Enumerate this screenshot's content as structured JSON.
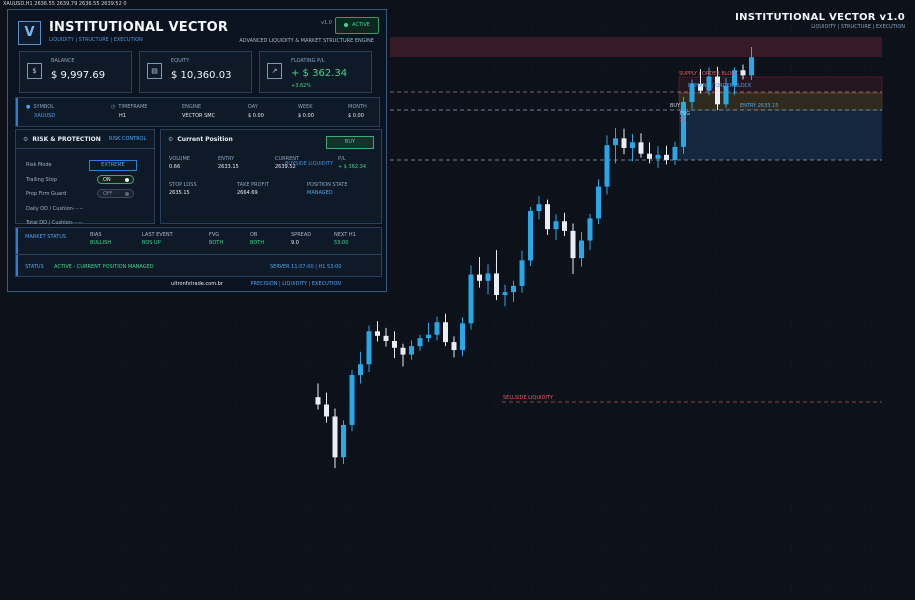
{
  "top_bar": {
    "ohlc_text": "XAUUSD,H1  2636.55  2639.79  2636.55  2639.52  0"
  },
  "watermark": {
    "title": "INSTITUTIONAL VECTOR  v1.0",
    "subtitle": "LIQUIDITY | STRUCTURE | EXECUTION"
  },
  "panel": {
    "logo_letter": "V",
    "title": "INSTITUTIONAL VECTOR",
    "subtitle": "LIQUIDITY | STRUCTURE | EXECUTION",
    "version": "v1.0",
    "status_badge": "ACTIVE",
    "tagline": "ADVANCED LIQUIDITY & MARKET STRUCTURE ENGINE",
    "cards": [
      {
        "icon": "dollar-icon",
        "glyph": "$",
        "label": "BALANCE",
        "value": "$ 9,997.69"
      },
      {
        "icon": "wallet-icon",
        "glyph": "▤",
        "label": "EQUITY",
        "value": "$ 10,360.03"
      },
      {
        "icon": "trend-up-icon",
        "glyph": "↗",
        "label": "FLOATING P/L",
        "value": "+ $ 362.34",
        "sub": "+3.62%"
      }
    ],
    "symbol_row": {
      "symbol_label": "SYMBOL",
      "symbol": "XAUUSD",
      "timeframe_label": "TIMEFRAME",
      "timeframe": "H1",
      "engine_label": "ENGINE",
      "engine": "VECTOR SMC",
      "day_label": "DAY",
      "day": "$ 0.00",
      "week_label": "WEEK",
      "week": "$ 0.00",
      "month_label": "MONTH",
      "month": "$ 0.00"
    },
    "risk": {
      "title": "RISK & PROTECTION",
      "tab": "RISK CONTROL",
      "risk_mode_label": "Risk Mode",
      "risk_mode": "EXTREME",
      "trailing_stop_label": "Trailing Stop",
      "trailing_stop": "ON",
      "prop_firm_label": "Prop Firm Guard",
      "prop_firm": "OFF",
      "daily_dd": "Daily DD / Cushion- - --",
      "total_dd": "Total DD / Cushion- - --"
    },
    "position": {
      "title": "Current Position",
      "side": "BUY",
      "volume_label": "VOLUME",
      "volume": "0.66",
      "entry_label": "ENTRY",
      "entry": "2633.15",
      "current_label": "CURRENT",
      "current": "2639.52",
      "pl_label": "P/L",
      "pl": "+ $ 362.34",
      "overlap_text": "BUYSIDE LIQUIDITY",
      "stop_loss_label": "STOP LOSS",
      "stop_loss": "2635.15",
      "take_profit_label": "TAKE PROFIT",
      "take_profit": "2664.69",
      "position_state_label": "POSITION STATE",
      "position_state": "MANAGED"
    },
    "market": {
      "status_label": "MARKET STATUS",
      "bias_label": "BIAS",
      "bias": "BULLISH",
      "last_event_label": "LAST EVENT",
      "last_event": "BOS UP",
      "fvg_label": "FVG",
      "fvg": "BOTH",
      "ob_label": "OB",
      "ob": "BOTH",
      "spread_label": "SPREAD",
      "spread": "9.0",
      "next_label": "NEXT H1",
      "next": "53:00",
      "status_word": "STATUS",
      "status_text": "ACTIVE - CURRENT POSITION MANAGED",
      "server_text": "SERVER 11:07:00  |  H1 53:00"
    },
    "footer": {
      "site": "ultronfxtrade.com.br",
      "tagline": "PRECISION | LIQUIDITY | EXECUTION"
    }
  },
  "chart_labels": {
    "supply": "SUPPLY / ORDER BLOCK",
    "demand": "DEMAND / ORDER BLOCK",
    "entry": "ENTRY  2633.15",
    "sellside": "SELLSIDE LIQUIDITY",
    "buyside_short": "BUY",
    "fvg_short": "FVG",
    "sl_short": "SL"
  },
  "colors": {
    "bull": "#29a8e8",
    "bear": "#e8eef4",
    "background": "#0c111a",
    "accent": "#2e7fd0",
    "green": "#3fd68a",
    "red": "#e04a4a"
  },
  "candles": [
    {
      "o": 2579.6,
      "h": 2582.0,
      "l": 2577.4,
      "c": 2578.3
    },
    {
      "o": 2578.3,
      "h": 2580.4,
      "l": 2575.1,
      "c": 2576.2
    },
    {
      "o": 2576.2,
      "h": 2577.6,
      "l": 2567.1,
      "c": 2569.0
    },
    {
      "o": 2569.0,
      "h": 2575.5,
      "l": 2567.8,
      "c": 2574.7
    },
    {
      "o": 2574.7,
      "h": 2584.4,
      "l": 2573.6,
      "c": 2583.5
    },
    {
      "o": 2583.5,
      "h": 2587.6,
      "l": 2582.0,
      "c": 2585.4
    },
    {
      "o": 2585.4,
      "h": 2592.2,
      "l": 2584.0,
      "c": 2591.2
    },
    {
      "o": 2591.2,
      "h": 2593.0,
      "l": 2589.4,
      "c": 2590.4
    },
    {
      "o": 2590.4,
      "h": 2591.8,
      "l": 2588.5,
      "c": 2589.5
    },
    {
      "o": 2589.5,
      "h": 2591.2,
      "l": 2586.5,
      "c": 2588.3
    },
    {
      "o": 2588.3,
      "h": 2589.0,
      "l": 2585.0,
      "c": 2587.1
    },
    {
      "o": 2587.1,
      "h": 2589.6,
      "l": 2586.2,
      "c": 2588.6
    },
    {
      "o": 2588.6,
      "h": 2590.6,
      "l": 2587.8,
      "c": 2590.0
    },
    {
      "o": 2590.0,
      "h": 2592.7,
      "l": 2589.3,
      "c": 2590.6
    },
    {
      "o": 2590.6,
      "h": 2593.8,
      "l": 2589.6,
      "c": 2592.8
    },
    {
      "o": 2592.8,
      "h": 2594.3,
      "l": 2588.6,
      "c": 2589.3
    },
    {
      "o": 2589.3,
      "h": 2590.3,
      "l": 2586.6,
      "c": 2587.9
    },
    {
      "o": 2587.9,
      "h": 2593.7,
      "l": 2586.8,
      "c": 2592.6
    },
    {
      "o": 2592.6,
      "h": 2602.8,
      "l": 2591.5,
      "c": 2601.2
    },
    {
      "o": 2601.2,
      "h": 2604.3,
      "l": 2598.9,
      "c": 2600.1
    },
    {
      "o": 2600.1,
      "h": 2603.0,
      "l": 2597.7,
      "c": 2601.4
    },
    {
      "o": 2601.4,
      "h": 2605.5,
      "l": 2596.7,
      "c": 2597.6
    },
    {
      "o": 2597.6,
      "h": 2599.4,
      "l": 2595.6,
      "c": 2598.1
    },
    {
      "o": 2598.1,
      "h": 2600.1,
      "l": 2596.4,
      "c": 2599.2
    },
    {
      "o": 2599.2,
      "h": 2605.4,
      "l": 2598.0,
      "c": 2603.7
    },
    {
      "o": 2603.7,
      "h": 2613.1,
      "l": 2602.7,
      "c": 2612.4
    },
    {
      "o": 2612.4,
      "h": 2615.0,
      "l": 2610.9,
      "c": 2613.6
    },
    {
      "o": 2613.6,
      "h": 2614.4,
      "l": 2608.2,
      "c": 2609.2
    },
    {
      "o": 2609.2,
      "h": 2611.8,
      "l": 2607.3,
      "c": 2610.6
    },
    {
      "o": 2610.6,
      "h": 2612.1,
      "l": 2608.0,
      "c": 2608.9
    },
    {
      "o": 2608.9,
      "h": 2610.2,
      "l": 2601.3,
      "c": 2604.1
    },
    {
      "o": 2604.1,
      "h": 2608.7,
      "l": 2602.6,
      "c": 2607.2
    },
    {
      "o": 2607.2,
      "h": 2611.9,
      "l": 2605.5,
      "c": 2611.1
    },
    {
      "o": 2611.1,
      "h": 2618.0,
      "l": 2610.1,
      "c": 2616.7
    },
    {
      "o": 2616.7,
      "h": 2625.7,
      "l": 2615.3,
      "c": 2624.0
    },
    {
      "o": 2624.0,
      "h": 2627.0,
      "l": 2620.8,
      "c": 2625.2
    },
    {
      "o": 2625.2,
      "h": 2626.9,
      "l": 2622.4,
      "c": 2623.5
    },
    {
      "o": 2623.5,
      "h": 2626.0,
      "l": 2621.2,
      "c": 2624.5
    },
    {
      "o": 2624.5,
      "h": 2626.1,
      "l": 2621.8,
      "c": 2622.5
    },
    {
      "o": 2622.5,
      "h": 2624.5,
      "l": 2620.8,
      "c": 2621.6
    },
    {
      "o": 2621.6,
      "h": 2623.8,
      "l": 2620.0,
      "c": 2622.3
    },
    {
      "o": 2622.3,
      "h": 2623.9,
      "l": 2620.6,
      "c": 2621.4
    },
    {
      "o": 2621.4,
      "h": 2624.6,
      "l": 2620.5,
      "c": 2623.7
    },
    {
      "o": 2623.7,
      "h": 2632.5,
      "l": 2622.5,
      "c": 2631.6
    },
    {
      "o": 2631.6,
      "h": 2635.6,
      "l": 2630.4,
      "c": 2634.8
    },
    {
      "o": 2634.8,
      "h": 2637.4,
      "l": 2633.1,
      "c": 2633.6
    },
    {
      "o": 2633.6,
      "h": 2637.7,
      "l": 2632.8,
      "c": 2636.1
    },
    {
      "o": 2636.1,
      "h": 2637.8,
      "l": 2630.2,
      "c": 2631.2
    },
    {
      "o": 2631.2,
      "h": 2635.8,
      "l": 2630.6,
      "c": 2634.5
    },
    {
      "o": 2634.5,
      "h": 2637.7,
      "l": 2632.8,
      "c": 2637.2
    },
    {
      "o": 2637.2,
      "h": 2638.2,
      "l": 2635.6,
      "c": 2636.3
    },
    {
      "o": 2636.3,
      "h": 2641.3,
      "l": 2635.5,
      "c": 2639.5
    }
  ]
}
